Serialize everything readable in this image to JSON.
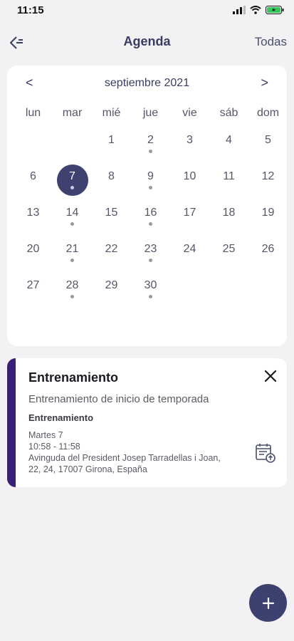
{
  "status": {
    "time": "11:15"
  },
  "nav": {
    "title": "Agenda",
    "filter_label": "Todas"
  },
  "calendar": {
    "prev": "<",
    "next": ">",
    "month_label": "septiembre 2021",
    "weekdays": [
      "lun",
      "mar",
      "mié",
      "jue",
      "vie",
      "sáb",
      "dom"
    ],
    "weeks": [
      [
        null,
        null,
        "1",
        "2",
        "3",
        "4",
        "5"
      ],
      [
        "6",
        "7",
        "8",
        "9",
        "10",
        "11",
        "12"
      ],
      [
        "13",
        "14",
        "15",
        "16",
        "17",
        "18",
        "19"
      ],
      [
        "20",
        "21",
        "22",
        "23",
        "24",
        "25",
        "26"
      ],
      [
        "27",
        "28",
        "29",
        "30",
        null,
        null,
        null
      ]
    ],
    "selected_day": "7",
    "days_with_events": [
      "2",
      "7",
      "9",
      "14",
      "16",
      "21",
      "23",
      "28",
      "30"
    ]
  },
  "event": {
    "title": "Entrenamiento",
    "subtitle": "Entrenamiento de inicio de temporada",
    "type": "Entrenamiento",
    "date": "Martes 7",
    "time": "10:58 - 11:58",
    "address_line1": "Avinguda del President Josep Tarradellas i Joan,",
    "address_line2": "22, 24, 17007 Girona, España",
    "accent_color": "#3a1e78"
  },
  "fab": {
    "label": "+"
  },
  "colors": {
    "primary": "#3f4271",
    "background": "#f2f2f4"
  }
}
